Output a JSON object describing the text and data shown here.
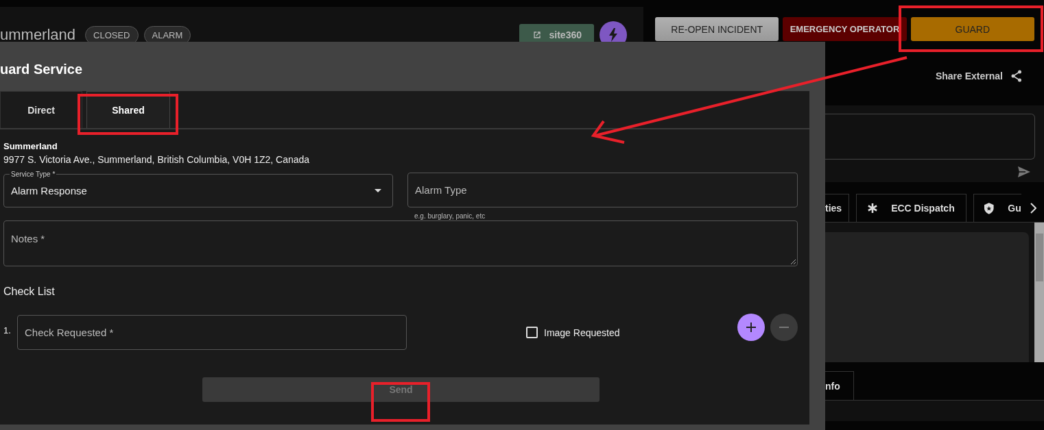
{
  "page_header": {
    "title": "ummerland",
    "badges": [
      "CLOSED",
      "ALARM"
    ],
    "link_button": "site360"
  },
  "actions": [
    {
      "label": "RE-OPEN INCIDENT",
      "kind": "neutral"
    },
    {
      "label": "EMERGENCY OPERATOR",
      "kind": "danger"
    },
    {
      "label": "GUARD",
      "kind": "warning"
    }
  ],
  "share": {
    "label": "Share External"
  },
  "side_tabs": [
    {
      "label": "ties",
      "kind": "plain"
    },
    {
      "label": "ECC Dispatch",
      "kind": "asterisk"
    },
    {
      "label": "Gu",
      "kind": "shield"
    }
  ],
  "bottom_tabs": [
    {
      "label": "nfo"
    }
  ],
  "modal": {
    "title": "uard Service",
    "tabs": [
      {
        "label": "Direct",
        "selected": false
      },
      {
        "label": "Shared",
        "selected": true
      }
    ],
    "site": {
      "name": "Summerland",
      "address": "9977 S. Victoria Ave., Summerland, British Columbia, V0H 1Z2, Canada"
    },
    "service_type": {
      "label": "Service Type *",
      "value": "Alarm Response"
    },
    "alarm_type": {
      "placeholder": "Alarm Type",
      "helper": "e.g. burglary, panic, etc"
    },
    "notes": {
      "placeholder": "Notes *"
    },
    "checklist": {
      "title": "Check List",
      "items": [
        {
          "number": "1.",
          "placeholder": "Check Requested *",
          "image_label": "Image Requested",
          "checked": false
        }
      ]
    },
    "send": {
      "label": "Send",
      "disabled": true
    }
  }
}
